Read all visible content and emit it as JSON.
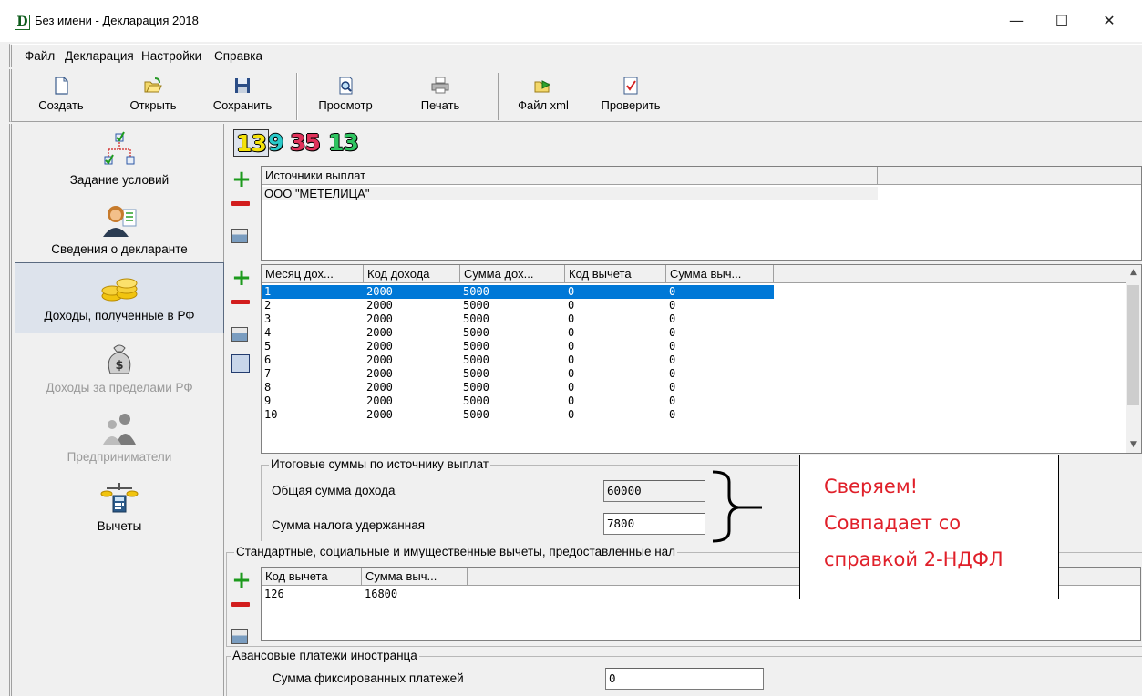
{
  "window": {
    "title": "Без имени - Декларация 2018",
    "logo_letter": "D",
    "minimize": "—",
    "maximize": "☐",
    "close": "✕"
  },
  "menu": [
    "Файл",
    "Декларация",
    "Настройки",
    "Справка"
  ],
  "toolbar": [
    {
      "label": "Создать",
      "icon": "new-document-icon"
    },
    {
      "label": "Открыть",
      "icon": "open-folder-icon"
    },
    {
      "label": "Сохранить",
      "icon": "save-disk-icon"
    },
    {
      "label": "Просмотр",
      "icon": "preview-icon"
    },
    {
      "label": "Печать",
      "icon": "printer-icon"
    },
    {
      "label": "Файл xml",
      "icon": "xml-export-icon"
    },
    {
      "label": "Проверить",
      "icon": "check-icon"
    }
  ],
  "nav": [
    {
      "label": "Задание условий",
      "icon": "conditions-tree-icon",
      "state": "normal"
    },
    {
      "label": "Сведения о декларанте",
      "icon": "declarant-person-icon",
      "state": "normal"
    },
    {
      "label": "Доходы, полученные в РФ",
      "icon": "coins-icon",
      "state": "active"
    },
    {
      "label": "Доходы за пределами РФ",
      "icon": "money-bag-icon",
      "state": "disabled"
    },
    {
      "label": "Предприниматели",
      "icon": "entrepreneurs-icon",
      "state": "disabled"
    },
    {
      "label": "Вычеты",
      "icon": "scales-calculator-icon",
      "state": "normal"
    }
  ],
  "rate_tabs": [
    {
      "label": "13",
      "color": "#f4e20b"
    },
    {
      "label": "9",
      "color": "#29c9c9"
    },
    {
      "label": "35",
      "color": "#e0325a"
    },
    {
      "label": "13",
      "color": "#2fc460"
    }
  ],
  "sources": {
    "header": "Источники выплат",
    "rows": [
      "ООО \"МЕТЕЛИЦА\""
    ]
  },
  "income": {
    "headers": [
      "Месяц дох...",
      "Код дохода",
      "Сумма дох...",
      "Код вычета",
      "Сумма выч..."
    ],
    "rows": [
      [
        "1",
        "2000",
        "5000",
        "0",
        "0"
      ],
      [
        "2",
        "2000",
        "5000",
        "0",
        "0"
      ],
      [
        "3",
        "2000",
        "5000",
        "0",
        "0"
      ],
      [
        "4",
        "2000",
        "5000",
        "0",
        "0"
      ],
      [
        "5",
        "2000",
        "5000",
        "0",
        "0"
      ],
      [
        "6",
        "2000",
        "5000",
        "0",
        "0"
      ],
      [
        "7",
        "2000",
        "5000",
        "0",
        "0"
      ],
      [
        "8",
        "2000",
        "5000",
        "0",
        "0"
      ],
      [
        "9",
        "2000",
        "5000",
        "0",
        "0"
      ],
      [
        "10",
        "2000",
        "5000",
        "0",
        "0"
      ]
    ],
    "selected_row": 0
  },
  "totals": {
    "title": "Итоговые суммы по источнику выплат",
    "total_income_label": "Общая сумма дохода",
    "total_income_value": "60000",
    "tax_withheld_label": "Сумма налога удержанная",
    "tax_withheld_value": "7800"
  },
  "deductions": {
    "title": "Стандартные, социальные и имущественные вычеты, предоставленные нал",
    "headers": [
      "Код вычета",
      "Сумма выч..."
    ],
    "rows": [
      [
        "126",
        "16800"
      ]
    ]
  },
  "advance": {
    "title": "Авансовые платежи иностранца",
    "fixed_payments_label": "Сумма фиксированных платежей",
    "fixed_payments_value": "0"
  },
  "callout": {
    "lines": [
      "Сверяем!",
      "Совпадает со",
      "справкой 2-НДФЛ"
    ],
    "color": "#e0202a"
  }
}
